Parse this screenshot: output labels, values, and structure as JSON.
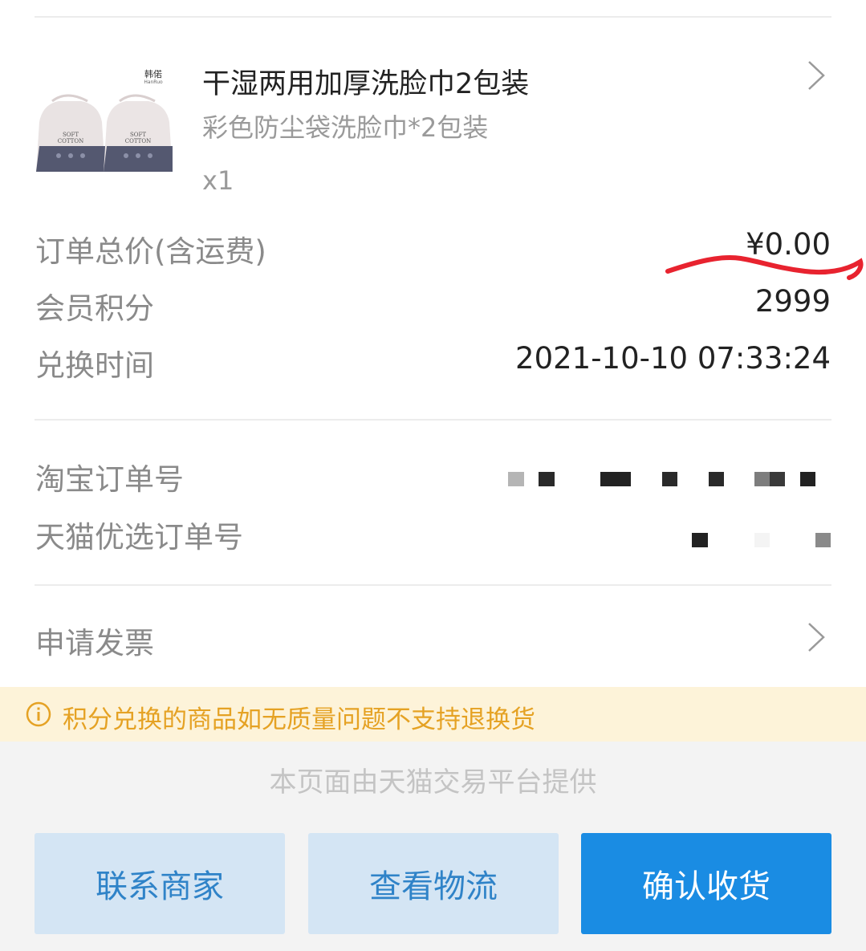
{
  "product": {
    "brand_logo_text": "韩偌 HanRuo",
    "name": "干湿两用加厚洗脸巾2包装",
    "spec": "彩色防尘袋洗脸巾*2包装",
    "quantity": "x1",
    "bag_text": "SOFT COTTON"
  },
  "order_info": {
    "total_label": "订单总价(含运费)",
    "total_value": "¥0.00",
    "points_label": "会员积分",
    "points_value": "2999",
    "time_label": "兑换时间",
    "time_value": "2021-10-10 07:33:24"
  },
  "order_ids": {
    "taobao_label": "淘宝订单号",
    "tmall_label": "天猫优选订单号"
  },
  "invoice": {
    "label": "申请发票"
  },
  "notice": {
    "text": "积分兑换的商品如无质量问题不支持退换货"
  },
  "footer": {
    "text": "本页面由天猫交易平台提供"
  },
  "actions": {
    "contact_label": "联系商家",
    "logistics_label": "查看物流",
    "confirm_label": "确认收货"
  },
  "colors": {
    "accent_blue": "#1a8ce3",
    "light_button": "#d4e5f4",
    "notice_bg": "#fdf3d9",
    "notice_text": "#e5a224",
    "annotation_red": "#e8232f"
  }
}
